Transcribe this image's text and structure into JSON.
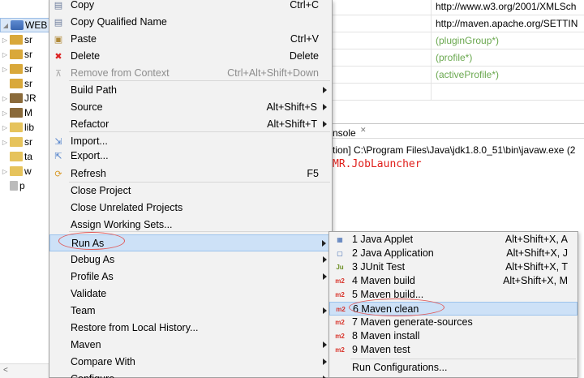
{
  "tree": {
    "rows": [
      {
        "label": "WEB",
        "arrow": "◢",
        "icon": "project-icon",
        "selected": true
      },
      {
        "label": "sr",
        "arrow": "▷",
        "icon": "source-folder-icon"
      },
      {
        "label": "sr",
        "arrow": "▷",
        "icon": "source-folder-icon"
      },
      {
        "label": "sr",
        "arrow": "▷",
        "icon": "source-folder-icon"
      },
      {
        "label": "sr",
        "arrow": "",
        "icon": "source-folder-icon"
      },
      {
        "label": "JR",
        "arrow": "▷",
        "icon": "library-icon"
      },
      {
        "label": "M",
        "arrow": "▷",
        "icon": "library-icon"
      },
      {
        "label": "lib",
        "arrow": "▷",
        "icon": "folder-icon"
      },
      {
        "label": "sr",
        "arrow": "▷",
        "icon": "folder-icon"
      },
      {
        "label": "ta",
        "arrow": "",
        "icon": "folder-icon"
      },
      {
        "label": "w",
        "arrow": "▷",
        "icon": "folder-icon"
      },
      {
        "label": "p",
        "arrow": "",
        "icon": "file-icon"
      }
    ]
  },
  "editor_table": {
    "rows": [
      {
        "value": "http://www.w3.org/2001/XMLSch",
        "style": "normal"
      },
      {
        "value": "http://maven.apache.org/SETTIN",
        "style": "normal"
      },
      {
        "value": "(pluginGroup*)",
        "style": "gray"
      },
      {
        "value": "(profile*)",
        "style": "gray"
      },
      {
        "value": "(activeProfile*)",
        "style": "gray"
      },
      {
        "value": "",
        "style": "normal"
      }
    ]
  },
  "console": {
    "tab_label": "nsole",
    "tab_close": "✕",
    "description": "tion] C:\\Program Files\\Java\\jdk1.8.0_51\\bin\\javaw.exe (2",
    "output_line": "MR.JobLauncher"
  },
  "context_menu": {
    "items": [
      {
        "label": "Copy",
        "accel": "Ctrl+C",
        "icon": "copy-icon",
        "glyph": "▤",
        "color": "#6b7b9b"
      },
      {
        "label": "Copy Qualified Name",
        "accel": "",
        "icon": "copy-qualified-icon",
        "glyph": "▤",
        "color": "#6b7b9b"
      },
      {
        "label": "Paste",
        "accel": "Ctrl+V",
        "icon": "paste-icon",
        "glyph": "▣",
        "color": "#b08a3a"
      },
      {
        "label": "Delete",
        "accel": "Delete",
        "icon": "delete-icon",
        "glyph": "✖",
        "color": "#d22"
      },
      {
        "label": "Remove from Context",
        "accel": "Ctrl+Alt+Shift+Down",
        "icon": "remove-context-icon",
        "glyph": "⊼",
        "color": "#aaa",
        "disabled": true
      },
      {
        "label": "Build Path",
        "accel": "",
        "submenu": true
      },
      {
        "label": "Source",
        "accel": "Alt+Shift+S",
        "submenu": true
      },
      {
        "label": "Refactor",
        "accel": "Alt+Shift+T",
        "submenu": true
      },
      {
        "label": "Import...",
        "accel": "",
        "icon": "import-icon",
        "glyph": "⇲",
        "color": "#4a7cc9"
      },
      {
        "label": "Export...",
        "accel": "",
        "icon": "export-icon",
        "glyph": "⇱",
        "color": "#4a7cc9"
      },
      {
        "label": "Refresh",
        "accel": "F5",
        "icon": "refresh-icon",
        "glyph": "⟳",
        "color": "#d89a2a"
      },
      {
        "label": "Close Project",
        "accel": ""
      },
      {
        "label": "Close Unrelated Projects",
        "accel": ""
      },
      {
        "label": "Assign Working Sets...",
        "accel": ""
      },
      {
        "label": "Run As",
        "accel": "",
        "submenu": true,
        "highlight": true
      },
      {
        "label": "Debug As",
        "accel": "",
        "submenu": true
      },
      {
        "label": "Profile As",
        "accel": "",
        "submenu": true
      },
      {
        "label": "Validate",
        "accel": ""
      },
      {
        "label": "Team",
        "accel": "",
        "submenu": true
      },
      {
        "label": "Restore from Local History...",
        "accel": ""
      },
      {
        "label": "Maven",
        "accel": "",
        "submenu": true
      },
      {
        "label": "Compare With",
        "accel": "",
        "submenu": true
      },
      {
        "label": "Configure",
        "accel": "",
        "submenu": true
      }
    ]
  },
  "run_as_submenu": {
    "items": [
      {
        "label": "1 Java Applet",
        "accel": "Alt+Shift+X, A",
        "icon": "java-applet-icon",
        "glyph": "▦",
        "cls": "ico-app"
      },
      {
        "label": "2 Java Application",
        "accel": "Alt+Shift+X, J",
        "icon": "java-application-icon",
        "glyph": "▢",
        "cls": "ico-app"
      },
      {
        "label": "3 JUnit Test",
        "accel": "Alt+Shift+X, T",
        "icon": "junit-icon",
        "glyph": "Ju",
        "cls": "ico-junit"
      },
      {
        "label": "4 Maven build",
        "accel": "Alt+Shift+X, M",
        "icon": "maven-m2-icon",
        "glyph": "m2",
        "cls": "ico-m2"
      },
      {
        "label": "5 Maven build...",
        "accel": "",
        "icon": "maven-m2-icon",
        "glyph": "m2",
        "cls": "ico-m2"
      },
      {
        "label": "6 Maven clean",
        "accel": "",
        "icon": "maven-m2-icon",
        "glyph": "m2",
        "cls": "ico-m2",
        "highlight": true
      },
      {
        "label": "7 Maven generate-sources",
        "accel": "",
        "icon": "maven-m2-icon",
        "glyph": "m2",
        "cls": "ico-m2"
      },
      {
        "label": "8 Maven install",
        "accel": "",
        "icon": "maven-m2-icon",
        "glyph": "m2",
        "cls": "ico-m2"
      },
      {
        "label": "9 Maven test",
        "accel": "",
        "icon": "maven-m2-icon",
        "glyph": "m2",
        "cls": "ico-m2"
      },
      {
        "label": "Run Configurations...",
        "accel": "",
        "icon": "",
        "glyph": "",
        "cls": ""
      }
    ]
  },
  "colors": {
    "menu_bg": "#f2f2f2",
    "highlight": "#cde1f7",
    "annotation_ellipse": "#e05a5a",
    "console_output": "#e0201c"
  }
}
